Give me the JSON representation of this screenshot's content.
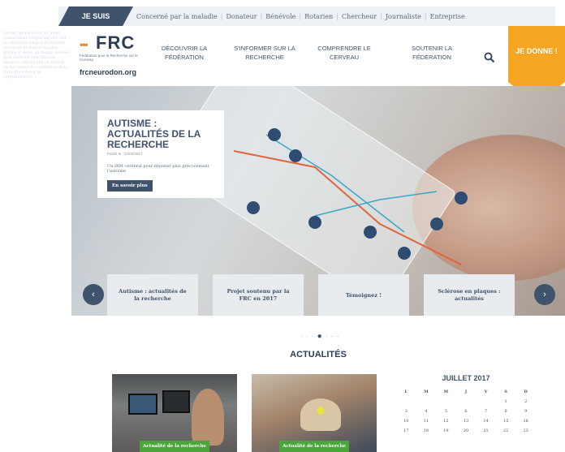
{
  "topbar": {
    "je_suis": "JE SUIS",
    "links": [
      "Concerné par la maladie",
      "Donateur",
      "Bénévole",
      "Rotarien",
      "Chercheur",
      "Journaliste",
      "Entreprise"
    ]
  },
  "header": {
    "logo_text": "FRC",
    "logo_tagline": "Fédération pour la Recherche sur le Cerveau",
    "logo_url": "frcneurodon.org",
    "nav": [
      "DÉCOUVRIR LA FÉDÉRATION",
      "S'INFORMER SUR LA RECHERCHE",
      "COMPRENDRE LE CERVEAU",
      "SOUTENIR LA FÉDÉRATION"
    ],
    "donate": "JE DONNE !"
  },
  "hero": {
    "title": "AUTISME : ACTUALITÉS DE LA RECHERCHE",
    "date": "Publié le : 22/03/2017",
    "description": "Un IRM cérébral pour dépister plus précocement l'autisme",
    "button": "En savoir plus",
    "slides": [
      "Autisme : actualités de la recherche",
      "Projet soutenu par la FRC en 2017",
      "Témoignez !",
      "Sclérose en plaques : actualités"
    ],
    "prev": "‹",
    "next": "›"
  },
  "news": {
    "section_title": "ACTUALITÉS",
    "cards": [
      {
        "label": "Actualité de la recherche"
      },
      {
        "label": "Actualité de la recherche"
      }
    ]
  },
  "calendar": {
    "month": "JUILLET 2017",
    "weekdays": [
      "L",
      "M",
      "M",
      "J",
      "V",
      "S",
      "D"
    ],
    "rows": [
      [
        "",
        "",
        "",
        "",
        "",
        "1",
        "2"
      ],
      [
        "3",
        "4",
        "5",
        "6",
        "7",
        "8",
        "9"
      ],
      [
        "10",
        "11",
        "12",
        "13",
        "14",
        "15",
        "16"
      ],
      [
        "17",
        "18",
        "19",
        "20",
        "21",
        "22",
        "23"
      ]
    ]
  }
}
